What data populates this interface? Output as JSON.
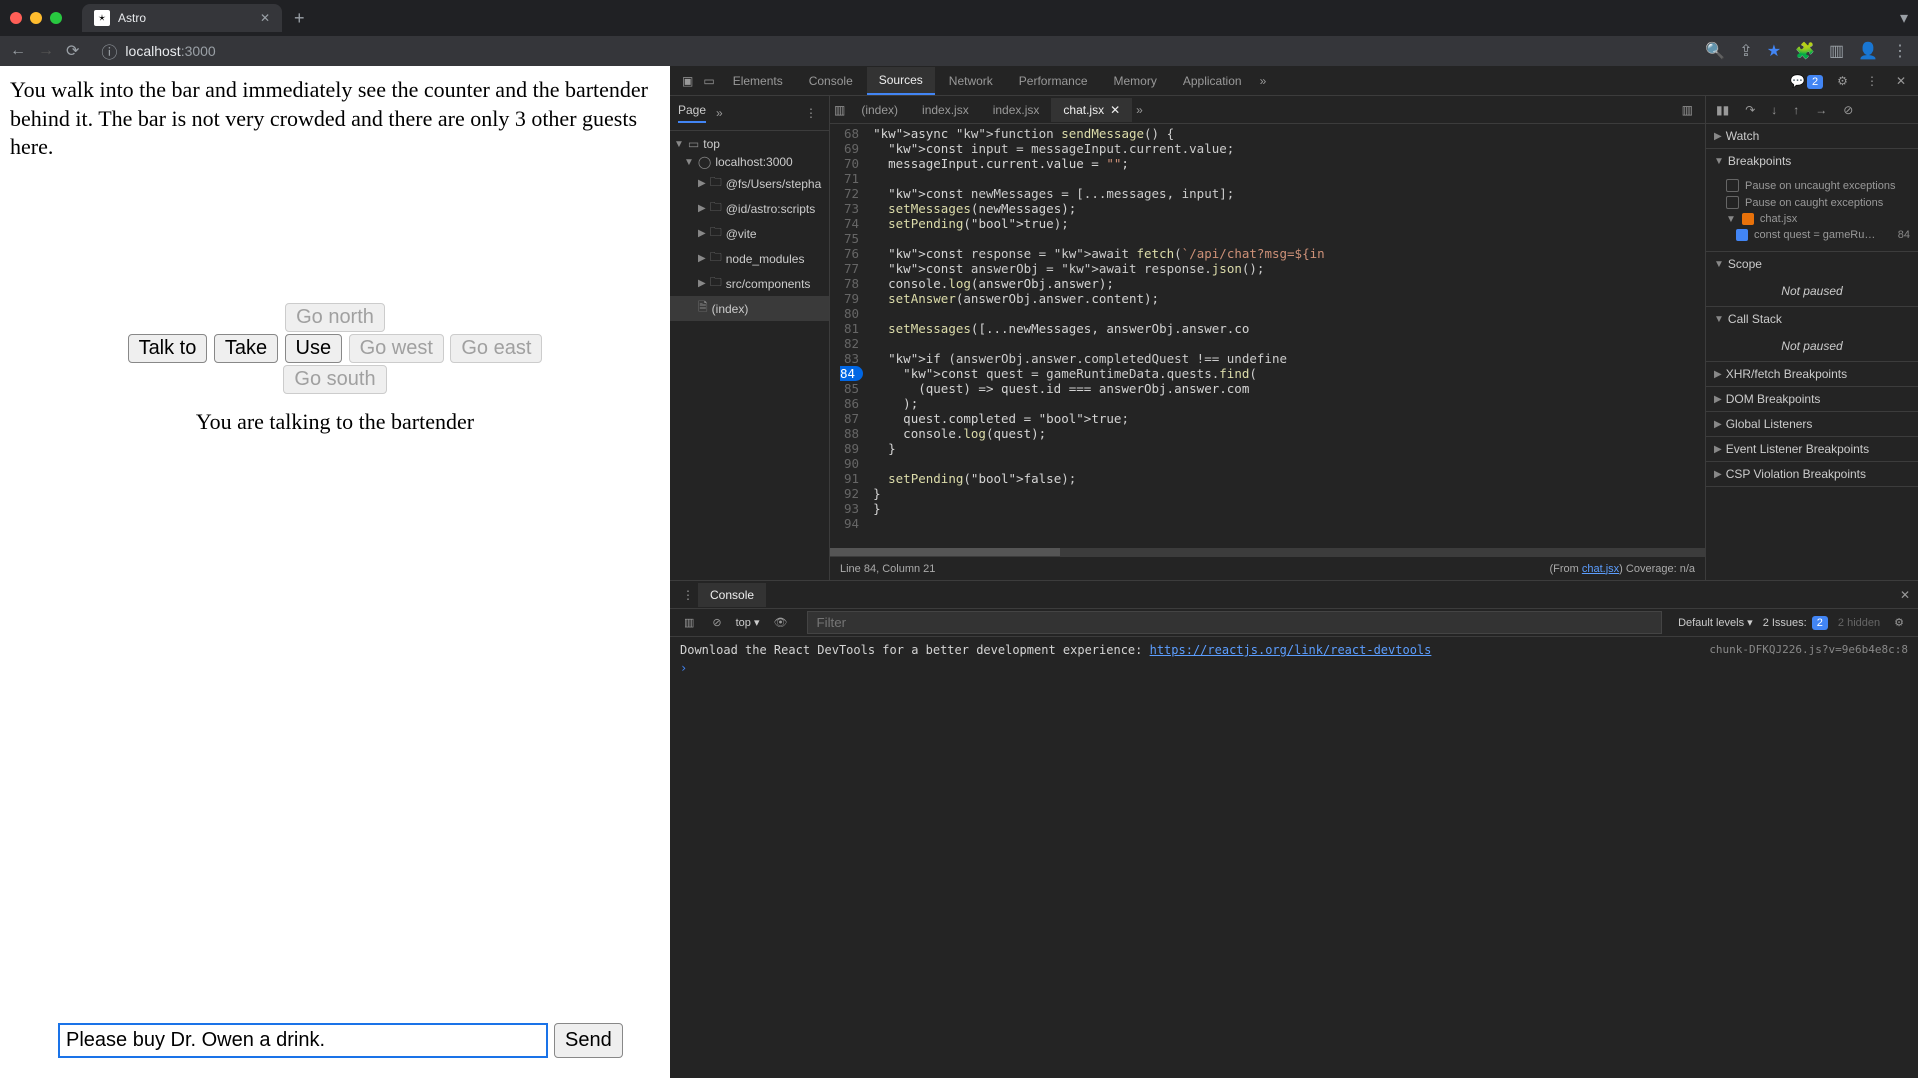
{
  "browser": {
    "tab_title": "Astro",
    "url_host": "localhost",
    "url_port": ":3000"
  },
  "game": {
    "narrative": "You walk into the bar and immediately see the counter and the bartender behind it. The bar is not very crowded and there are only 3 other guests here.",
    "buttons": {
      "talk": "Talk to",
      "take": "Take",
      "use": "Use",
      "north": "Go north",
      "west": "Go west",
      "east": "Go east",
      "south": "Go south"
    },
    "status": "You are talking to the bartender",
    "input_value": "Please buy Dr. Owen a drink.",
    "send": "Send"
  },
  "devtools": {
    "tabs": [
      "Elements",
      "Console",
      "Sources",
      "Network",
      "Performance",
      "Memory",
      "Application"
    ],
    "active_tab": "Sources",
    "issue_count": "2",
    "page_tab": "Page",
    "tree": {
      "top": "top",
      "host": "localhost:3000",
      "items": [
        "@fs/Users/stepha",
        "@id/astro:scripts",
        "@vite",
        "node_modules",
        "src/components",
        "(index)"
      ]
    },
    "file_tabs": [
      "(index)",
      "index.jsx",
      "index.jsx",
      "chat.jsx"
    ],
    "active_file": "chat.jsx",
    "code_start_line": 68,
    "breakpoint_line": 84,
    "code_lines": [
      "async function sendMessage() {",
      "  const input = messageInput.current.value;",
      "  messageInput.current.value = \"\";",
      "",
      "  const newMessages = [...messages, input];",
      "  setMessages(newMessages);",
      "  setPending(true);",
      "",
      "  const response = await fetch(`/api/chat?msg=${in",
      "  const answerObj = await response.json();",
      "  console.log(answerObj.answer);",
      "  setAnswer(answerObj.answer.content);",
      "",
      "  setMessages([...newMessages, answerObj.answer.co",
      "",
      "  if (answerObj.answer.completedQuest !== undefine",
      "    const quest = gameRuntimeData.quests.find(",
      "      (quest) => quest.id === answerObj.answer.com",
      "    );",
      "    quest.completed = true;",
      "    console.log(quest);",
      "  }",
      "",
      "  setPending(false);",
      "}",
      "}",
      ""
    ],
    "editor_status_left": "Line 84, Column 21",
    "editor_status_right_prefix": "(From ",
    "editor_status_link": "chat.jsx",
    "editor_status_right_suffix": ") Coverage: n/a",
    "debug_sections": [
      "Watch",
      "Breakpoints",
      "Scope",
      "Call Stack",
      "XHR/fetch Breakpoints",
      "DOM Breakpoints",
      "Global Listeners",
      "Event Listener Breakpoints",
      "CSP Violation Breakpoints"
    ],
    "pause_uncaught": "Pause on uncaught exceptions",
    "pause_caught": "Pause on caught exceptions",
    "bp_file": "chat.jsx",
    "bp_snippet": "const quest = gameRu…",
    "bp_line": "84",
    "not_paused": "Not paused",
    "console": {
      "tab": "Console",
      "context": "top",
      "filter_placeholder": "Filter",
      "levels": "Default levels",
      "issues_label": "2 Issues:",
      "issues_count": "2",
      "hidden": "2 hidden",
      "src": "chunk-DFKQJ226.js?v=9e6b4e8c:8",
      "msg_prefix": "Download the React DevTools for a better development experience: ",
      "msg_link": "https://reactjs.org/link/react-devtools"
    }
  }
}
